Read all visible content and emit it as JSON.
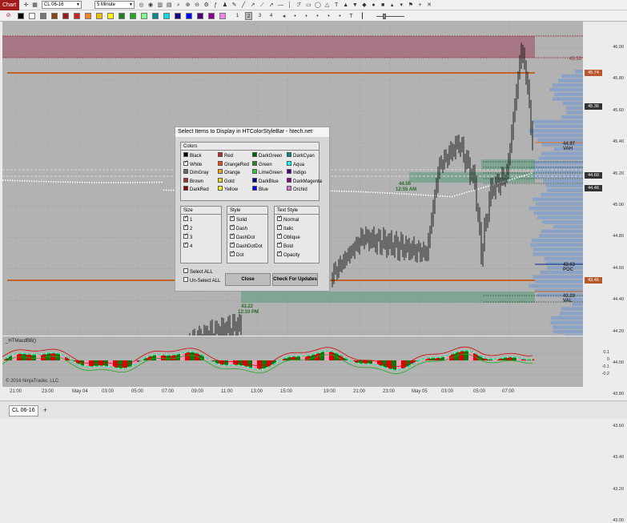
{
  "toolbar": {
    "chart_tab": "Chart",
    "instrument": "CL 06-16",
    "interval": "5 Minute",
    "icons1": [
      "crosshair-icon",
      "eye-icon",
      "data-box-icon",
      "bar-type-icon",
      "instrument-icon",
      "zoom-in-icon",
      "zoom-out-icon",
      "properties-icon",
      "indicators-icon",
      "strategies-icon",
      "pencil-icon",
      "line-icon",
      "ray-icon",
      "ext-line-icon",
      "arrow-line-icon",
      "horizontal-line-icon",
      "vertical-line-icon",
      "fib-icon",
      "rectangle-icon",
      "ellipse-icon",
      "triangle-icon",
      "text-icon",
      "arrow-up-icon",
      "arrow-down-icon",
      "diamond-icon",
      "dot-icon",
      "square-icon",
      "triangle-up-icon",
      "triangle-down-icon",
      "flag-icon",
      "plus-icon",
      "clear-icon"
    ],
    "swatch_colors": [
      "#000000",
      "#ffffff",
      "#777777",
      "#8b4513",
      "#9b1b1b",
      "#cc2222",
      "#ff7f27",
      "#e8c000",
      "#ffff00",
      "#1e7d1e",
      "#22aa22",
      "#7fff7f",
      "#008b8b",
      "#00e0e0",
      "#00008b",
      "#0000ff",
      "#4b0082",
      "#8b008b",
      "#ee82ee"
    ],
    "numbers": [
      "1",
      "2",
      "3",
      "4"
    ]
  },
  "chart": {
    "price_labels": [
      "46.00",
      "45.80",
      "45.60",
      "45.40",
      "45.20",
      "45.00",
      "44.80",
      "44.60",
      "44.40",
      "44.20",
      "44.00",
      "43.80",
      "43.60",
      "43.40",
      "43.20",
      "43.00"
    ],
    "right_tags": [
      {
        "text": "45.74",
        "color": "#b8582a"
      },
      {
        "text": "45.36",
        "color": "#333333"
      },
      {
        "text": "44.60",
        "color": "#333333"
      },
      {
        "text": "44.46",
        "color": "#333333"
      },
      {
        "text": "43.46",
        "color": "#b8582a"
      }
    ],
    "level_labels": [
      "44.97 VAH",
      "43.63 POC",
      "43.23 VAL",
      "45.50"
    ],
    "annotations": [
      "44.55",
      "12:55 AM",
      "43.22",
      "12:10 PM"
    ],
    "osc_title": "_HTMacdBB()",
    "osc_labels": [
      "0.1",
      "0",
      "-0.1",
      "-0.2"
    ],
    "copyright": "© 2016 NinjaTrader, LLC",
    "time_labels": [
      "21:00",
      "23:00",
      "May 04",
      "03:00",
      "05:00",
      "07:00",
      "09:00",
      "11:00",
      "13:00",
      "15:00",
      "19:00",
      "21:00",
      "23:00",
      "May 05",
      "03:00",
      "05:00",
      "07:00"
    ]
  },
  "dialog": {
    "title": "Select Items to Display in HTColorStyleBar - htech.net",
    "colors_header": "Colors",
    "colors": [
      {
        "name": "Black",
        "hex": "#000000",
        "checked": false
      },
      {
        "name": "Red",
        "hex": "#cc2222",
        "checked": false
      },
      {
        "name": "DarkGreen",
        "hex": "#006400",
        "checked": false
      },
      {
        "name": "DarkCyan",
        "hex": "#008b8b",
        "checked": false
      },
      {
        "name": "White",
        "hex": "#ffffff",
        "checked": true
      },
      {
        "name": "OrangeRed",
        "hex": "#ff4500",
        "checked": false
      },
      {
        "name": "Green",
        "hex": "#228b22",
        "checked": false
      },
      {
        "name": "Aqua",
        "hex": "#00ffff",
        "checked": false
      },
      {
        "name": "DimGray",
        "hex": "#696969",
        "checked": false
      },
      {
        "name": "Orange",
        "hex": "#ffa500",
        "checked": false
      },
      {
        "name": "LimeGreen",
        "hex": "#32cd32",
        "checked": false
      },
      {
        "name": "Indigo",
        "hex": "#4b0082",
        "checked": false
      },
      {
        "name": "Brown",
        "hex": "#a52a2a",
        "checked": false
      },
      {
        "name": "Gold",
        "hex": "#ffd700",
        "checked": false
      },
      {
        "name": "DarkBlue",
        "hex": "#00008b",
        "checked": false
      },
      {
        "name": "DarkMagenta",
        "hex": "#8b008b",
        "checked": false
      },
      {
        "name": "DarkRed",
        "hex": "#8b0000",
        "checked": false
      },
      {
        "name": "Yellow",
        "hex": "#ffff00",
        "checked": false
      },
      {
        "name": "Blue",
        "hex": "#0000ff",
        "checked": false
      },
      {
        "name": "Orchid",
        "hex": "#da70d6",
        "checked": false
      }
    ],
    "size_header": "Size",
    "sizes": [
      "1",
      "2",
      "3",
      "4"
    ],
    "style_header": "Style",
    "styles": [
      "Solid",
      "Dash",
      "DashDot",
      "DashDotDot",
      "Dot"
    ],
    "text_style_header": "Text Style",
    "text_styles": [
      "Normal",
      "Italic",
      "Oblique",
      "Bold",
      "Opacity"
    ],
    "select_all": "Select ALL",
    "unselect_all": "Un-Select ALL",
    "close": "Close",
    "check_updates": "Check For Updates"
  },
  "status": {
    "tab": "CL 06-16",
    "add": "+"
  }
}
